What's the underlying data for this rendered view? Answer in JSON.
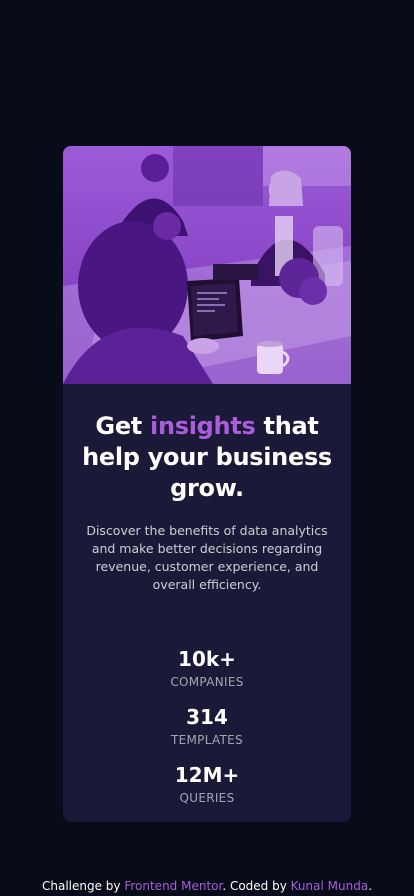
{
  "card": {
    "title_before": "Get ",
    "title_accent": "insights",
    "title_after": " that help your business grow.",
    "description": "Discover the benefits of data analytics and make better decisions regarding revenue, customer experience, and overall efficiency.",
    "stats": [
      {
        "value": "10k+",
        "label": "COMPANIES"
      },
      {
        "value": "314",
        "label": "TEMPLATES"
      },
      {
        "value": "12M+",
        "label": "QUERIES"
      }
    ]
  },
  "attribution": {
    "prefix": "Challenge by ",
    "challenge_link": "Frontend Mentor",
    "middle": ". Coded by ",
    "author_link": "Kunal Munda",
    "suffix": "."
  },
  "colors": {
    "page_background": "#080b18",
    "card_background": "#1b1938",
    "accent": "#aa5cdb"
  }
}
